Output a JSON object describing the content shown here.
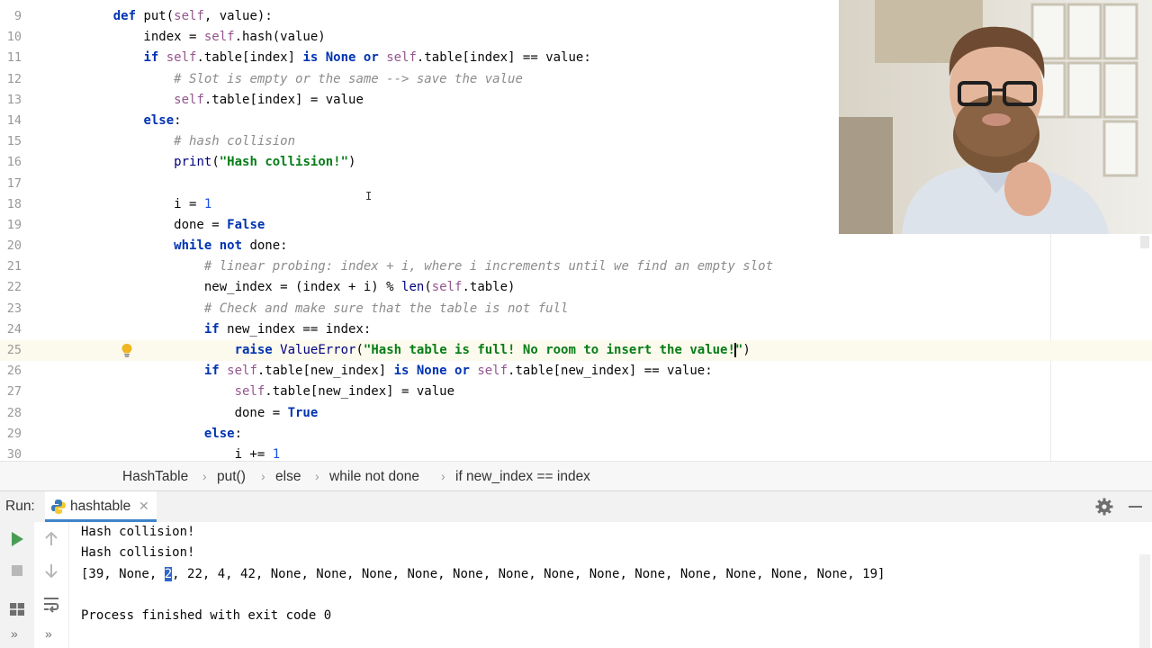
{
  "editor": {
    "line_numbers": [
      "9",
      "10",
      "11",
      "12",
      "13",
      "14",
      "15",
      "16",
      "17",
      "18",
      "19",
      "20",
      "21",
      "22",
      "23",
      "24",
      "25",
      "26",
      "27",
      "28",
      "29",
      "30"
    ]
  },
  "breadcrumb": {
    "items": [
      "HashTable",
      "put()",
      "else",
      "while not done",
      "if new_index == index"
    ]
  },
  "run": {
    "label": "Run:",
    "tab_label": "hashtable",
    "output": [
      "Hash collision!",
      "Hash collision!",
      "[39, None, 2, 22, 4, 42, None, None, None, None, None, None, None, None, None, None, None, None, None, 19]",
      "",
      "Process finished with exit code 0"
    ],
    "selected_text": "2"
  },
  "icons": {
    "bulb": "lightbulb-icon",
    "run": "run-icon",
    "stop": "stop-icon",
    "up": "arrow-up-icon",
    "down": "arrow-down-icon",
    "gear": "gear-icon",
    "minimize": "minimize-icon",
    "python": "python-icon",
    "close": "close-icon",
    "layout": "layout-icon",
    "wrap": "soft-wrap-icon",
    "more": "more-icon"
  },
  "colors": {
    "keyword": "#0033b3",
    "self": "#94558d",
    "comment": "#8c8c8c",
    "string": "#067d17",
    "number": "#1750eb",
    "current_line": "#fcfaed",
    "selection": "#2f65ca",
    "run_green": "#499c54"
  }
}
